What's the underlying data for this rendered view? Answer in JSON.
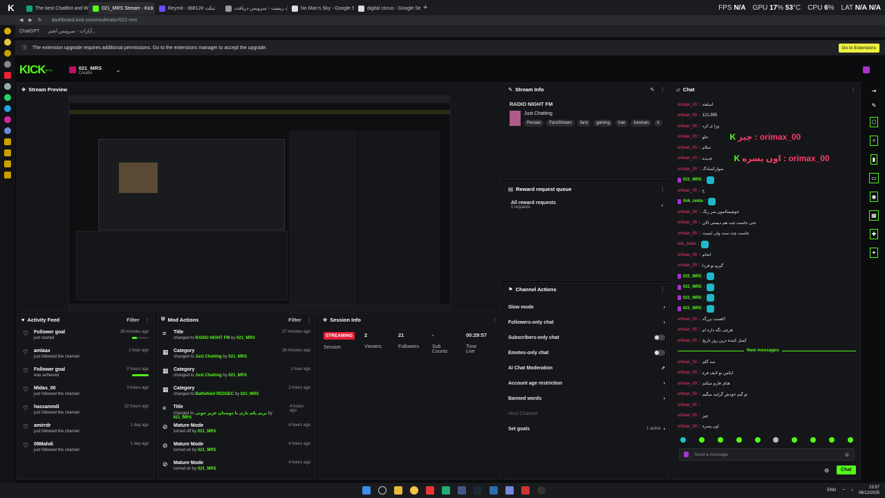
{
  "browser": {
    "tabs": [
      {
        "label": "The best ChatBot and Wi",
        "color": "#10a37f"
      },
      {
        "label": "021_MRS Stream - Kick D",
        "color": "#53fc18"
      },
      {
        "label": "Reymit - 38812# تیکت",
        "color": "#6d4aff"
      },
      {
        "label": "بلاگ ریمیت - سرویس دریافت",
        "color": "#999"
      },
      {
        "label": "No Man's Sky - Google S",
        "color": "#ddd"
      },
      {
        "label": "digital circus - Google Se",
        "color": "#ddd"
      }
    ],
    "address": "dashboard.kick.com/moderator/021-mrs",
    "address_domain": "kick.com",
    "bookmarks": [
      "ChatGPT",
      "آپارات - سرویس اشتر..."
    ]
  },
  "osd": {
    "fps_label": "FPS",
    "fps": "N/A",
    "gpu_label": "GPU",
    "gpu": "17",
    "gpu_unit": "%",
    "gpu_temp": "53",
    "gpu_temp_unit": "°C",
    "cpu_label": "CPU",
    "cpu": "6",
    "cpu_unit": "%",
    "lat_label": "LAT",
    "lat": "N/A",
    "lat2": "N/A"
  },
  "infobar": {
    "message": "The extension upgrade requires additional permissions. Go to the extensions manager to accept the upgrade.",
    "button": "Go to Extensions"
  },
  "header": {
    "logo": "KICK",
    "beta": "BETA",
    "channel": "021_MRS",
    "role": "Creator"
  },
  "stream_preview": {
    "title": "Stream Preview"
  },
  "stream_info": {
    "title": "Stream Info",
    "stream_title": "RADIO NIGHT FM",
    "category": "Just Chatting",
    "tags": [
      "Persian",
      "FarsiStream",
      "farsi",
      "gaming",
      "Iran",
      "Iraninan",
      "Ir"
    ]
  },
  "reward": {
    "title": "Reward request queue",
    "all": "All reward requests",
    "count": "0 requests"
  },
  "channel_actions": {
    "title": "Channel Actions",
    "items": [
      {
        "label": "Slow mode",
        "ctrl": "chevron"
      },
      {
        "label": "Followers-only chat",
        "ctrl": "chevron"
      },
      {
        "label": "Subscribers-only chat",
        "ctrl": "toggle"
      },
      {
        "label": "Emotes-only chat",
        "ctrl": "toggle"
      },
      {
        "label": "AI Chat Moderation",
        "ctrl": "ext"
      },
      {
        "label": "Account age restriction",
        "ctrl": "chevron"
      },
      {
        "label": "Banned words",
        "ctrl": "chevron"
      },
      {
        "label": "Host Channel",
        "ctrl": "none"
      },
      {
        "label": "Set goals",
        "ctrl": "chevron"
      }
    ],
    "set_goals_badge": "1 active"
  },
  "activity": {
    "title": "Activity Feed",
    "filter": "Filter",
    "items": [
      {
        "title": "Follower goal",
        "sub": "just started",
        "time": "29 minutes ago",
        "progress": 0.3
      },
      {
        "title": "amlaax",
        "sub": "just followed the channel",
        "time": "1 hour ago"
      },
      {
        "title": "Follower goal",
        "sub": "was achieved",
        "time": "2 hours ago",
        "progress": 1
      },
      {
        "title": "Midas_00",
        "sub": "just followed the channel",
        "time": "3 hours ago"
      },
      {
        "title": "hassanmdi",
        "sub": "just followed the channel",
        "time": "22 hours ago"
      },
      {
        "title": "amirrdr",
        "sub": "just followed the channel",
        "time": "1 day ago"
      },
      {
        "title": "09Mahdi",
        "sub": "just followed the channel",
        "time": "1 day ago"
      }
    ]
  },
  "mod": {
    "title": "Mod Actions",
    "filter": "Filter",
    "items": [
      {
        "title": "Title",
        "pre": "changed to",
        "val": "RADIO NIGHT FM",
        "by": "021_MRS",
        "time": "27 minutes ago"
      },
      {
        "title": "Category",
        "pre": "changed to",
        "val": "Just Chatting",
        "by": "021_MRS",
        "time": "28 minutes ago"
      },
      {
        "title": "Category",
        "pre": "changed to",
        "val": "Just Chatting",
        "by": "021_MRS",
        "time": "1 hour ago"
      },
      {
        "title": "Category",
        "pre": "changed to",
        "val": "Battlefield REDSEC",
        "by": "021_MRS",
        "time": "2 hours ago"
      },
      {
        "title": "Title",
        "pre": "changed to",
        "val": "بریم یکم بازی با دوستان عزیز جونی",
        "by": "021_MRS",
        "time": "4 hours ago"
      },
      {
        "title": "Mature Mode",
        "pre": "turned off by",
        "val": "",
        "by": "021_MRS",
        "time": "4 hours ago"
      },
      {
        "title": "Mature Mode",
        "pre": "turned on by",
        "val": "",
        "by": "021_MRS",
        "time": "4 hours ago"
      },
      {
        "title": "Mature Mode",
        "pre": "turned on by",
        "val": "",
        "by": "021_MRS",
        "time": "4 hours ago"
      }
    ]
  },
  "session": {
    "title": "Session Info",
    "status": "STREAMING",
    "status_label": "Session",
    "stats": [
      {
        "value": "2",
        "label": "Viewers"
      },
      {
        "value": "21",
        "label": "Followers"
      },
      {
        "value": "-",
        "label": "Sub Counts"
      },
      {
        "value": "00:29:57",
        "label": "Time Live"
      }
    ]
  },
  "chat": {
    "title": "Chat",
    "new_messages": "New messages",
    "placeholder": "Send a message",
    "send": "Chat",
    "lines": [
      {
        "user": "orimax_00",
        "msg": "اسلحه"
      },
      {
        "user": "orimax_00",
        "msg": "121,955"
      },
      {
        "user": "orimax_00",
        "msg": "ورا ی کرد"
      },
      {
        "user": "orimax_00",
        "msg": "حلو",
        "big": "چیز : orimax_00"
      },
      {
        "user": "orimax_00",
        "msg": "سلام"
      },
      {
        "user": "orimax_00",
        "msg": "جدیده",
        "big": "اون پسره : orimax_00"
      },
      {
        "user": "orimax_00",
        "msg": "سوارکسادگ"
      },
      {
        "user": "021_MRS",
        "msg": "",
        "emote": true,
        "mod": true
      },
      {
        "user": "orimax_00",
        "msg": "ع"
      },
      {
        "user": "link_zelda",
        "msg": "",
        "emote": true,
        "mod": true
      },
      {
        "user": "orimax_00",
        "msg": "خوشسالمون سر زنگ"
      },
      {
        "user": "orimax_00",
        "msg": "حتی جاست چت هم دیستی الان"
      },
      {
        "user": "orimax_00",
        "msg": "جاست چت ست ولی ایست"
      },
      {
        "user": "link_zelda",
        "msg": "",
        "emote": true
      },
      {
        "user": "orimax_00",
        "msg": "انجام"
      },
      {
        "user": "orimax_00",
        "msg": "گیرم تو فردا"
      },
      {
        "user": "021_MRS",
        "msg": "",
        "emote": true,
        "mod": true
      },
      {
        "user": "021_MRS",
        "msg": "",
        "emote": true,
        "mod": true
      },
      {
        "user": "021_MRS",
        "msg": "",
        "emote": true,
        "mod": true
      },
      {
        "user": "021_MRS",
        "msg": "",
        "emote": true,
        "mod": true
      },
      {
        "user": "orimax_00",
        "msg": "هست بزرگه!!"
      },
      {
        "user": "orimax_00",
        "msg": "هرچی نگه داره ام"
      },
      {
        "user": "orimax_00",
        "msg": "کسل کننده ترین روز تاریخ"
      }
    ],
    "lines_after": [
      {
        "user": "orimax_00",
        "msg": "سه گلم"
      },
      {
        "user": "orimax_00",
        "msg": "ایکس تو لایف فره"
      },
      {
        "user": "orimax_00",
        "msg": "هنای فارم میکنم"
      },
      {
        "user": "orimax_00",
        "msg": "تو گیم خودش گرابید میگیم"
      },
      {
        "user": "orimax_00",
        "msg": ""
      },
      {
        "user": "orimax_00",
        "msg": "چیز"
      },
      {
        "user": "orimax_00",
        "msg": "اون پسره"
      }
    ]
  },
  "taskbar": {
    "lang": "ENG",
    "time": "23:57",
    "date": "06/12/2025"
  },
  "colors": {
    "accent": "#53fc18",
    "streaming": "#e0203a",
    "username": "#ff3b6b"
  }
}
